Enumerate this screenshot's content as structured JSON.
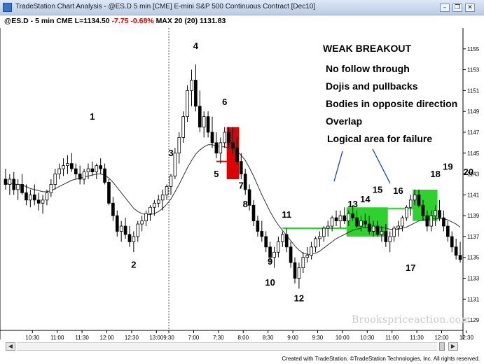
{
  "window": {
    "title": "TradeStation Chart Analysis - @ES.D 5 min [CME] E-mini S&P 500 Continuous Contract [Dec10]",
    "minimize": "–",
    "restore": "❐",
    "close": "✕"
  },
  "info": {
    "symbol": "@ES.D - 5 min  CME  L=1134.50",
    "change": "-7.75 -0.68%",
    "indicator": "MAX 20 (20)  1131.83"
  },
  "footer": "Created with TradeStation. ©TradeStation Technologies, Inc. All rights reserved.",
  "watermark": "Brookspriceaction.com",
  "scrollbar": {
    "left": "◀",
    "right": "▶"
  },
  "chart_data": {
    "type": "candlestick",
    "ylim": [
      1128,
      1157
    ],
    "ytick_values": [
      1129,
      1131,
      1133,
      1135,
      1137,
      1139,
      1141,
      1143,
      1145,
      1147,
      1149,
      1151,
      1153,
      1155
    ],
    "ytick_labels": [
      "1129",
      "1131",
      "1133",
      "1135",
      "1137",
      "1139",
      "1141",
      "1143",
      "1145",
      "1147",
      "1149",
      "1151",
      "1153",
      "1155"
    ],
    "xticks": [
      {
        "i": 6.5,
        "label": "10:30"
      },
      {
        "i": 12.5,
        "label": "11:00"
      },
      {
        "i": 18.5,
        "label": "11:30"
      },
      {
        "i": 24.5,
        "label": "12:00"
      },
      {
        "i": 30.5,
        "label": "12:30"
      },
      {
        "i": 36.5,
        "label": "13:00"
      },
      {
        "i": 39.5,
        "label": "9:30"
      },
      {
        "i": 45.5,
        "label": "7:00"
      },
      {
        "i": 51.5,
        "label": "7:30"
      },
      {
        "i": 57.5,
        "label": "8:00"
      },
      {
        "i": 63.5,
        "label": "8:30"
      },
      {
        "i": 69.5,
        "label": "9:00"
      },
      {
        "i": 75.5,
        "label": "9:30"
      },
      {
        "i": 81.5,
        "label": "10:00"
      },
      {
        "i": 87.5,
        "label": "10:30"
      },
      {
        "i": 93.5,
        "label": "11:00"
      },
      {
        "i": 99.5,
        "label": "11:30"
      },
      {
        "i": 105.5,
        "label": "12:00"
      },
      {
        "i": 111.5,
        "label": "12:30"
      },
      {
        "i": 117.5,
        "label": "13:00"
      }
    ],
    "session_break_index": 39.5,
    "ohlc": [
      [
        1142.5,
        1143.5,
        1141.5,
        1142.0
      ],
      [
        1142.0,
        1143.0,
        1141.0,
        1142.5
      ],
      [
        1142.5,
        1143.2,
        1141.0,
        1141.5
      ],
      [
        1141.5,
        1142.5,
        1140.5,
        1142.0
      ],
      [
        1142.0,
        1143.0,
        1141.0,
        1141.2
      ],
      [
        1141.2,
        1142.0,
        1140.0,
        1140.5
      ],
      [
        1140.5,
        1141.5,
        1139.8,
        1141.0
      ],
      [
        1141.0,
        1142.0,
        1140.0,
        1140.5
      ],
      [
        1140.5,
        1141.2,
        1139.5,
        1140.2
      ],
      [
        1140.2,
        1141.0,
        1139.2,
        1140.5
      ],
      [
        1140.5,
        1141.5,
        1140.0,
        1141.2
      ],
      [
        1141.2,
        1142.5,
        1140.8,
        1142.0
      ],
      [
        1142.0,
        1143.5,
        1141.5,
        1143.0
      ],
      [
        1143.0,
        1144.0,
        1142.5,
        1143.5
      ],
      [
        1143.5,
        1144.5,
        1142.8,
        1143.8
      ],
      [
        1143.8,
        1144.8,
        1143.0,
        1144.0
      ],
      [
        1144.0,
        1145.0,
        1143.2,
        1143.5
      ],
      [
        1143.5,
        1144.0,
        1142.5,
        1143.0
      ],
      [
        1143.0,
        1143.8,
        1142.0,
        1142.5
      ],
      [
        1142.5,
        1143.5,
        1142.0,
        1143.2
      ],
      [
        1143.2,
        1144.0,
        1142.5,
        1143.5
      ],
      [
        1143.5,
        1144.2,
        1142.8,
        1143.2
      ],
      [
        1143.2,
        1144.0,
        1142.5,
        1143.8
      ],
      [
        1143.8,
        1144.5,
        1143.0,
        1143.5
      ],
      [
        1143.5,
        1144.0,
        1142.0,
        1142.2
      ],
      [
        1142.2,
        1142.5,
        1140.0,
        1140.2
      ],
      [
        1140.2,
        1140.8,
        1138.5,
        1139.0
      ],
      [
        1139.0,
        1139.5,
        1137.0,
        1137.5
      ],
      [
        1137.5,
        1138.5,
        1136.5,
        1138.0
      ],
      [
        1138.0,
        1138.8,
        1136.8,
        1137.2
      ],
      [
        1137.2,
        1138.0,
        1136.0,
        1136.5
      ],
      [
        1136.5,
        1137.5,
        1135.5,
        1137.0
      ],
      [
        1137.0,
        1138.5,
        1136.5,
        1138.2
      ],
      [
        1138.2,
        1139.0,
        1137.5,
        1138.5
      ],
      [
        1138.5,
        1139.5,
        1138.0,
        1139.2
      ],
      [
        1139.2,
        1140.0,
        1138.5,
        1139.8
      ],
      [
        1139.8,
        1140.5,
        1139.0,
        1140.2
      ],
      [
        1140.2,
        1141.0,
        1139.8,
        1140.5
      ],
      [
        1140.5,
        1141.5,
        1139.5,
        1141.0
      ],
      [
        1141.0,
        1142.0,
        1140.5,
        1141.8
      ],
      [
        1141.8,
        1143.0,
        1141.0,
        1142.8
      ],
      [
        1142.8,
        1145.5,
        1142.5,
        1145.0
      ],
      [
        1145.0,
        1147.0,
        1144.0,
        1146.5
      ],
      [
        1146.5,
        1149.0,
        1146.0,
        1148.5
      ],
      [
        1148.5,
        1151.5,
        1148.0,
        1151.0
      ],
      [
        1151.0,
        1153.0,
        1149.5,
        1152.0
      ],
      [
        1152.0,
        1153.5,
        1149.0,
        1149.5
      ],
      [
        1149.5,
        1151.0,
        1147.0,
        1147.5
      ],
      [
        1147.5,
        1149.0,
        1146.5,
        1148.5
      ],
      [
        1148.5,
        1149.0,
        1146.5,
        1147.0
      ],
      [
        1147.0,
        1148.5,
        1145.5,
        1146.0
      ],
      [
        1146.0,
        1147.0,
        1144.5,
        1145.0
      ],
      [
        1145.0,
        1146.5,
        1144.0,
        1146.0
      ],
      [
        1146.0,
        1147.5,
        1145.5,
        1147.0
      ],
      [
        1147.0,
        1147.5,
        1145.5,
        1146.0
      ],
      [
        1146.0,
        1147.5,
        1145.0,
        1145.5
      ],
      [
        1145.5,
        1146.5,
        1144.0,
        1144.2
      ],
      [
        1144.2,
        1145.0,
        1142.5,
        1143.0
      ],
      [
        1143.0,
        1143.5,
        1141.0,
        1141.5
      ],
      [
        1141.5,
        1142.0,
        1139.5,
        1140.0
      ],
      [
        1140.0,
        1140.5,
        1138.0,
        1138.5
      ],
      [
        1138.5,
        1139.0,
        1137.0,
        1137.5
      ],
      [
        1137.5,
        1138.5,
        1136.5,
        1137.0
      ],
      [
        1137.0,
        1137.5,
        1135.5,
        1136.0
      ],
      [
        1136.0,
        1136.5,
        1134.5,
        1135.0
      ],
      [
        1135.0,
        1136.0,
        1134.0,
        1135.5
      ],
      [
        1135.5,
        1137.0,
        1135.0,
        1136.5
      ],
      [
        1136.5,
        1137.5,
        1136.0,
        1137.2
      ],
      [
        1137.2,
        1137.8,
        1135.5,
        1136.0
      ],
      [
        1136.0,
        1136.5,
        1134.0,
        1134.5
      ],
      [
        1134.5,
        1135.0,
        1132.5,
        1133.0
      ],
      [
        1133.0,
        1134.5,
        1132.0,
        1134.0
      ],
      [
        1134.0,
        1135.5,
        1133.5,
        1135.0
      ],
      [
        1135.0,
        1136.0,
        1134.5,
        1135.2
      ],
      [
        1135.2,
        1136.5,
        1134.8,
        1136.0
      ],
      [
        1136.0,
        1137.0,
        1135.5,
        1136.8
      ],
      [
        1136.8,
        1137.5,
        1136.0,
        1137.0
      ],
      [
        1137.0,
        1138.0,
        1136.5,
        1137.8
      ],
      [
        1137.8,
        1138.5,
        1137.0,
        1138.0
      ],
      [
        1138.0,
        1139.0,
        1137.5,
        1138.8
      ],
      [
        1138.8,
        1139.5,
        1138.0,
        1138.5
      ],
      [
        1138.5,
        1139.5,
        1137.8,
        1139.0
      ],
      [
        1139.0,
        1139.8,
        1138.2,
        1138.5
      ],
      [
        1138.5,
        1139.5,
        1138.0,
        1139.2
      ],
      [
        1139.2,
        1140.0,
        1138.5,
        1138.8
      ],
      [
        1138.8,
        1139.5,
        1137.8,
        1138.0
      ],
      [
        1138.0,
        1139.0,
        1137.5,
        1138.5
      ],
      [
        1138.5,
        1139.2,
        1137.8,
        1138.2
      ],
      [
        1138.2,
        1139.0,
        1137.2,
        1137.5
      ],
      [
        1137.5,
        1138.5,
        1137.0,
        1138.0
      ],
      [
        1138.0,
        1138.5,
        1137.0,
        1137.2
      ],
      [
        1137.2,
        1138.0,
        1136.5,
        1137.5
      ],
      [
        1137.5,
        1138.2,
        1136.0,
        1136.5
      ],
      [
        1136.5,
        1137.5,
        1135.5,
        1137.0
      ],
      [
        1137.0,
        1138.0,
        1136.5,
        1137.8
      ],
      [
        1137.8,
        1138.5,
        1137.0,
        1138.0
      ],
      [
        1138.0,
        1139.0,
        1137.5,
        1138.8
      ],
      [
        1138.8,
        1140.0,
        1138.5,
        1139.8
      ],
      [
        1139.8,
        1141.0,
        1139.0,
        1140.5
      ],
      [
        1140.5,
        1141.5,
        1140.0,
        1141.0
      ],
      [
        1141.0,
        1141.5,
        1139.8,
        1140.0
      ],
      [
        1140.0,
        1140.5,
        1138.5,
        1139.0
      ],
      [
        1139.0,
        1139.5,
        1137.5,
        1138.0
      ],
      [
        1138.0,
        1139.5,
        1137.5,
        1139.0
      ],
      [
        1139.0,
        1140.0,
        1138.0,
        1139.5
      ],
      [
        1139.5,
        1140.5,
        1138.5,
        1138.8
      ],
      [
        1138.8,
        1139.5,
        1137.5,
        1138.0
      ],
      [
        1138.0,
        1138.5,
        1136.5,
        1137.0
      ],
      [
        1137.0,
        1137.5,
        1135.5,
        1136.0
      ],
      [
        1136.0,
        1136.8,
        1134.8,
        1135.2
      ],
      [
        1135.2,
        1136.5,
        1134.5,
        1134.8
      ]
    ],
    "ma": [
      1142.0,
      1142.1,
      1142.0,
      1142.0,
      1141.9,
      1141.8,
      1141.6,
      1141.5,
      1141.4,
      1141.3,
      1141.3,
      1141.4,
      1141.6,
      1141.8,
      1142.0,
      1142.2,
      1142.4,
      1142.5,
      1142.6,
      1142.7,
      1142.8,
      1142.9,
      1143.0,
      1143.0,
      1142.9,
      1142.6,
      1142.2,
      1141.7,
      1141.2,
      1140.7,
      1140.2,
      1139.7,
      1139.4,
      1139.2,
      1139.1,
      1139.1,
      1139.2,
      1139.4,
      1139.7,
      1140.1,
      1140.6,
      1141.3,
      1142.0,
      1142.8,
      1143.6,
      1144.3,
      1144.9,
      1145.3,
      1145.6,
      1145.8,
      1145.8,
      1145.7,
      1145.6,
      1145.6,
      1145.5,
      1145.4,
      1145.2,
      1144.8,
      1144.3,
      1143.6,
      1142.8,
      1141.9,
      1141.0,
      1140.2,
      1139.4,
      1138.7,
      1138.1,
      1137.6,
      1137.1,
      1136.6,
      1136.1,
      1135.7,
      1135.4,
      1135.3,
      1135.3,
      1135.4,
      1135.6,
      1135.9,
      1136.2,
      1136.5,
      1136.8,
      1137.0,
      1137.2,
      1137.4,
      1137.6,
      1137.7,
      1137.8,
      1137.9,
      1137.9,
      1137.9,
      1137.9,
      1137.9,
      1137.8,
      1137.7,
      1137.7,
      1137.7,
      1137.8,
      1137.9,
      1138.1,
      1138.3,
      1138.5,
      1138.6,
      1138.6,
      1138.7,
      1138.7,
      1138.7,
      1138.7,
      1138.6,
      1138.4,
      1138.2,
      1137.9
    ],
    "highlights": [
      {
        "from": 53.5,
        "to": 56.5,
        "ylow": 1142.5,
        "yhigh": 1147.5,
        "color": "#e00000"
      },
      {
        "from": 82.5,
        "to": 92.5,
        "ylow": 1137.0,
        "yhigh": 1139.8,
        "color": "#2ed12e"
      },
      {
        "from": 98.5,
        "to": 104.5,
        "ylow": 1138.5,
        "yhigh": 1141.5,
        "color": "#2ed12e"
      }
    ],
    "levels": [
      {
        "from": 51,
        "to": 54,
        "y": 1144.2,
        "color": "#e00000"
      },
      {
        "from": 67,
        "to": 90,
        "y": 1137.8,
        "color": "#19e019"
      },
      {
        "from": 86,
        "to": 101,
        "y": 1139.7,
        "color": "#19e019"
      }
    ],
    "labels": [
      {
        "text": "1",
        "i": 21,
        "y": 1148.2
      },
      {
        "text": "2",
        "i": 31,
        "y": 1134.0
      },
      {
        "text": "3",
        "i": 40,
        "y": 1144.7
      },
      {
        "text": "4",
        "i": 46,
        "y": 1155.0
      },
      {
        "text": "5",
        "i": 51,
        "y": 1142.7
      },
      {
        "text": "6",
        "i": 53,
        "y": 1149.6
      },
      {
        "text": "7",
        "i": 57,
        "y": 1141.6
      },
      {
        "text": "8",
        "i": 58,
        "y": 1139.8
      },
      {
        "text": "9",
        "i": 64,
        "y": 1134.3
      },
      {
        "text": "10",
        "i": 64,
        "y": 1132.3
      },
      {
        "text": "11",
        "i": 68,
        "y": 1138.8
      },
      {
        "text": "12",
        "i": 71,
        "y": 1130.8
      },
      {
        "text": "13",
        "i": 84,
        "y": 1139.8
      },
      {
        "text": "14",
        "i": 87,
        "y": 1140.3
      },
      {
        "text": "15",
        "i": 90,
        "y": 1141.2
      },
      {
        "text": "16",
        "i": 95,
        "y": 1141.1
      },
      {
        "text": "17",
        "i": 98,
        "y": 1133.7
      },
      {
        "text": "18",
        "i": 104,
        "y": 1142.7
      },
      {
        "text": "19",
        "i": 107,
        "y": 1143.4
      },
      {
        "text": "20",
        "i": 112,
        "y": 1142.9
      }
    ],
    "annotations": {
      "title": "WEAK BREAKOUT",
      "lines": [
        "No follow through",
        "Dojis and pullbacks",
        "Bodies in opposite direction",
        "Overlap",
        "Logical area for failure"
      ]
    }
  }
}
